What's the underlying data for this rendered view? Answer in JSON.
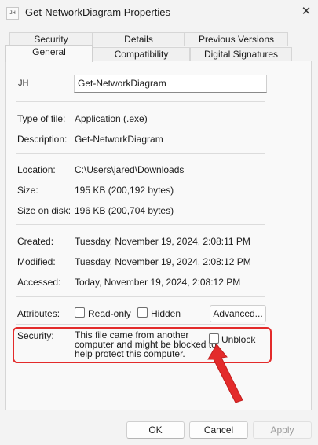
{
  "window": {
    "title": "Get-NetworkDiagram Properties",
    "icon_text": "JH"
  },
  "tabs": {
    "row1": [
      "Security",
      "Details",
      "Previous Versions"
    ],
    "row2": [
      "General",
      "Compatibility",
      "Digital Signatures"
    ],
    "active": "General"
  },
  "general": {
    "icon_text": "JH",
    "file_name": "Get-NetworkDiagram",
    "type_label": "Type of file:",
    "type_value": "Application (.exe)",
    "description_label": "Description:",
    "description_value": "Get-NetworkDiagram",
    "location_label": "Location:",
    "location_value": "C:\\Users\\jared\\Downloads",
    "size_label": "Size:",
    "size_value": "195 KB (200,192 bytes)",
    "size_on_disk_label": "Size on disk:",
    "size_on_disk_value": "196 KB (200,704 bytes)",
    "created_label": "Created:",
    "created_value": "Tuesday, November 19, 2024, 2:08:11 PM",
    "modified_label": "Modified:",
    "modified_value": "Tuesday, November 19, 2024, 2:08:12 PM",
    "accessed_label": "Accessed:",
    "accessed_value": "Today, November 19, 2024, 2:08:12 PM",
    "attributes_label": "Attributes:",
    "readonly_label": "Read-only",
    "hidden_label": "Hidden",
    "advanced_label": "Advanced...",
    "security_label": "Security:",
    "security_lines": [
      "This file came from another",
      "computer and might be blocked to",
      "help protect this computer."
    ],
    "unblock_label": "Unblock",
    "highlight_color": "#e32b2b"
  },
  "footer": {
    "ok_label": "OK",
    "cancel_label": "Cancel",
    "apply_label": "Apply"
  }
}
